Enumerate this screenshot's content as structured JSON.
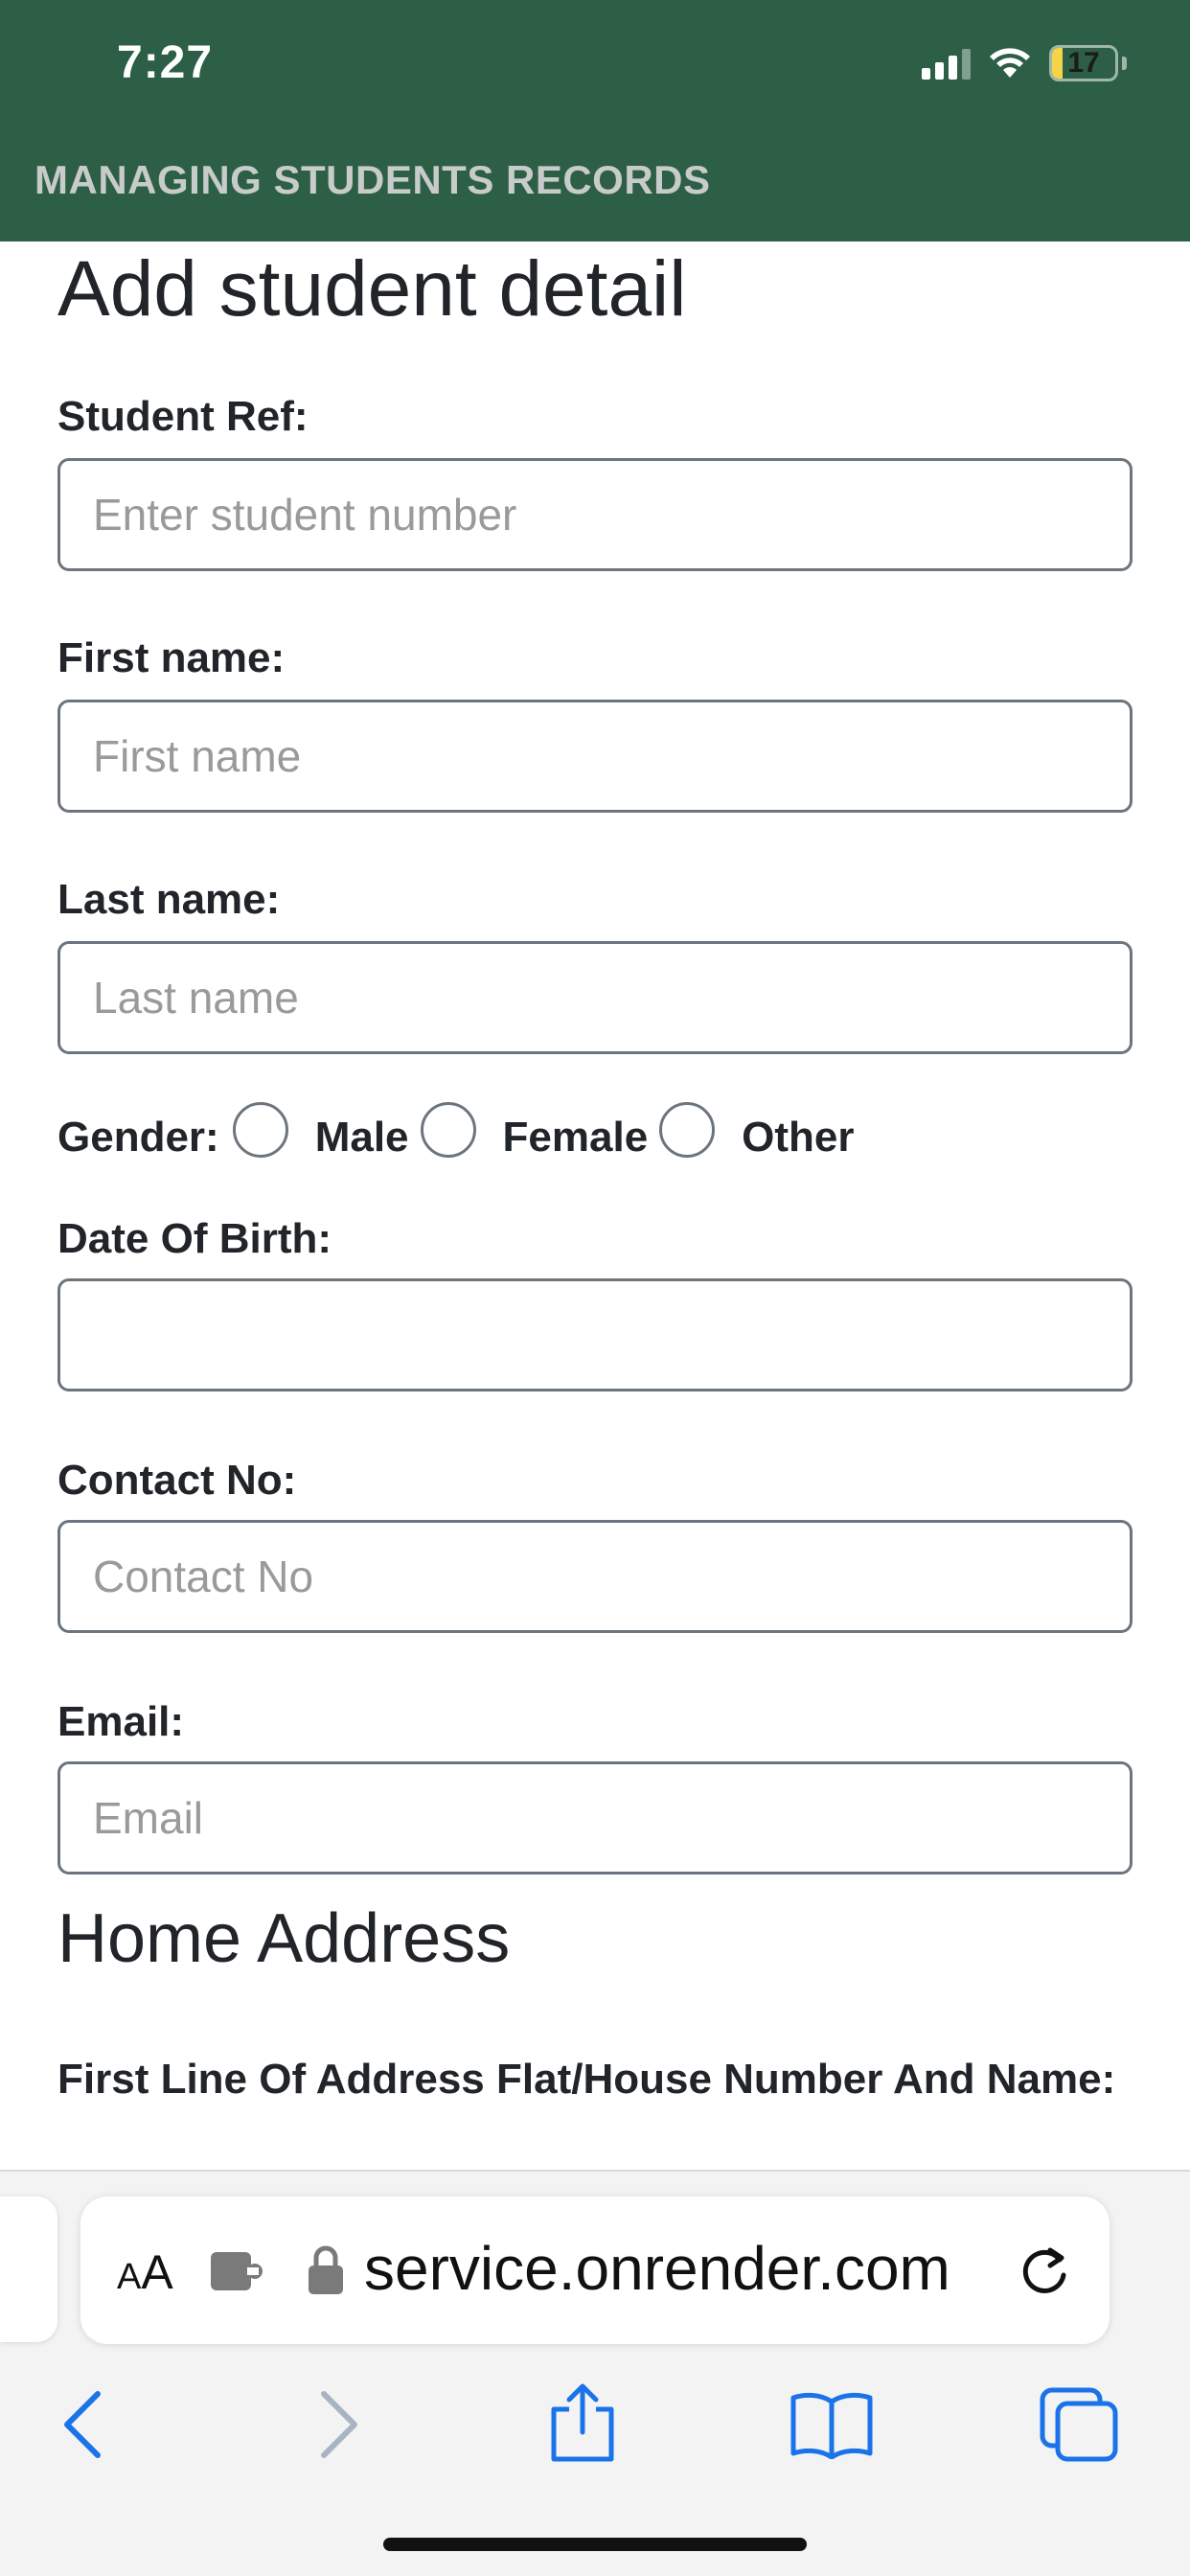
{
  "status_bar": {
    "time": "7:27",
    "battery_level": "17"
  },
  "app_header": {
    "title": "MANAGING STUDENTS RECORDS",
    "color": "#2c5f45"
  },
  "form": {
    "title": "Add student detail",
    "student_ref": {
      "label": "Student Ref:",
      "placeholder": "Enter student number",
      "value": ""
    },
    "first_name": {
      "label": "First name:",
      "placeholder": "First name",
      "value": ""
    },
    "last_name": {
      "label": "Last name:",
      "placeholder": "Last name",
      "value": ""
    },
    "gender": {
      "label": "Gender:",
      "options": [
        "Male",
        "Female",
        "Other"
      ],
      "selected": ""
    },
    "dob": {
      "label": "Date Of Birth:",
      "value": ""
    },
    "contact": {
      "label": "Contact No:",
      "placeholder": "Contact No",
      "value": ""
    },
    "email": {
      "label": "Email:",
      "placeholder": "Email",
      "value": ""
    },
    "home_address": {
      "title": "Home Address",
      "first_line_label": "First Line Of Address Flat/House Number And Name:"
    }
  },
  "browser": {
    "text_size_label": "AA",
    "domain": "service.onrender.com",
    "icons": [
      "extension-icon",
      "lock-icon",
      "reload-icon",
      "back-icon",
      "forward-icon",
      "share-icon",
      "bookmarks-icon",
      "tabs-icon"
    ],
    "accent": "#1a73e8"
  }
}
